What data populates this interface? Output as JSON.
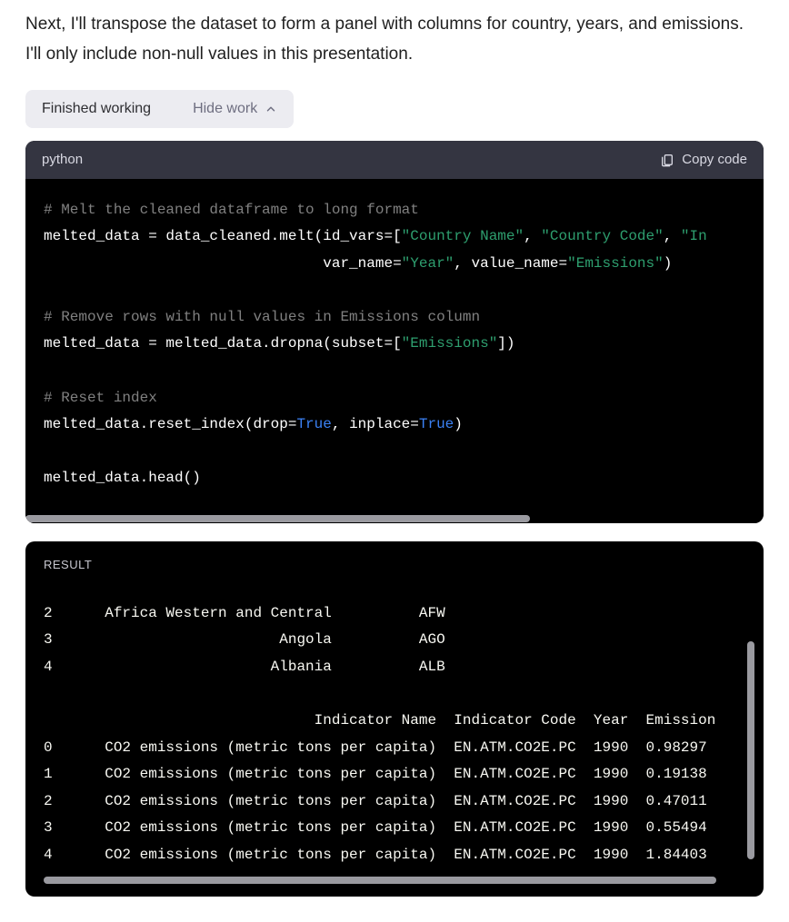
{
  "intro": "Next, I'll transpose the dataset to form a panel with columns for country, years, and emissions. I'll only include non-null values in this presentation.",
  "status": {
    "label": "Finished working",
    "toggle": "Hide work"
  },
  "code": {
    "lang": "python",
    "copy": "Copy code",
    "lines": [
      {
        "type": "comment",
        "text": "# Melt the cleaned dataframe to long format"
      },
      {
        "type": "mixed",
        "parts": [
          {
            "t": "def",
            "v": "melted_data = data_cleaned.melt(id_vars=["
          },
          {
            "t": "str",
            "v": "\"Country Name\""
          },
          {
            "t": "def",
            "v": ", "
          },
          {
            "t": "str",
            "v": "\"Country Code\""
          },
          {
            "t": "def",
            "v": ", "
          },
          {
            "t": "str",
            "v": "\"In"
          }
        ]
      },
      {
        "type": "mixed",
        "parts": [
          {
            "t": "def",
            "v": "                                var_name="
          },
          {
            "t": "str",
            "v": "\"Year\""
          },
          {
            "t": "def",
            "v": ", value_name="
          },
          {
            "t": "str",
            "v": "\"Emissions\""
          },
          {
            "t": "def",
            "v": ")"
          }
        ]
      },
      {
        "type": "blank"
      },
      {
        "type": "comment",
        "text": "# Remove rows with null values in Emissions column"
      },
      {
        "type": "mixed",
        "parts": [
          {
            "t": "def",
            "v": "melted_data = melted_data.dropna(subset=["
          },
          {
            "t": "str",
            "v": "\"Emissions\""
          },
          {
            "t": "def",
            "v": "])"
          }
        ]
      },
      {
        "type": "blank"
      },
      {
        "type": "comment",
        "text": "# Reset index"
      },
      {
        "type": "mixed",
        "parts": [
          {
            "t": "def",
            "v": "melted_data.reset_index(drop="
          },
          {
            "t": "kw",
            "v": "True"
          },
          {
            "t": "def",
            "v": ", inplace="
          },
          {
            "t": "kw",
            "v": "True"
          },
          {
            "t": "def",
            "v": ")"
          }
        ]
      },
      {
        "type": "blank"
      },
      {
        "type": "mixed",
        "parts": [
          {
            "t": "def",
            "v": "melted_data.head()"
          }
        ]
      }
    ],
    "hscroll_thumb_width": 555
  },
  "result": {
    "label": "RESULT",
    "top_rows": [
      {
        "idx": "2",
        "country": "Africa Western and Central",
        "code": "AFW"
      },
      {
        "idx": "3",
        "country": "Angola",
        "code": "AGO"
      },
      {
        "idx": "4",
        "country": "Albania",
        "code": "ALB"
      }
    ],
    "headers": [
      "Indicator Name",
      "Indicator Code",
      "Year",
      "Emission"
    ],
    "bottom_rows": [
      {
        "idx": "0",
        "ind": "CO2 emissions (metric tons per capita)",
        "code": "EN.ATM.CO2E.PC",
        "year": "1990",
        "em": "0.98297"
      },
      {
        "idx": "1",
        "ind": "CO2 emissions (metric tons per capita)",
        "code": "EN.ATM.CO2E.PC",
        "year": "1990",
        "em": "0.19138"
      },
      {
        "idx": "2",
        "ind": "CO2 emissions (metric tons per capita)",
        "code": "EN.ATM.CO2E.PC",
        "year": "1990",
        "em": "0.47011"
      },
      {
        "idx": "3",
        "ind": "CO2 emissions (metric tons per capita)",
        "code": "EN.ATM.CO2E.PC",
        "year": "1990",
        "em": "0.55494"
      },
      {
        "idx": "4",
        "ind": "CO2 emissions (metric tons per capita)",
        "code": "EN.ATM.CO2E.PC",
        "year": "1990",
        "em": "1.84403"
      }
    ]
  }
}
